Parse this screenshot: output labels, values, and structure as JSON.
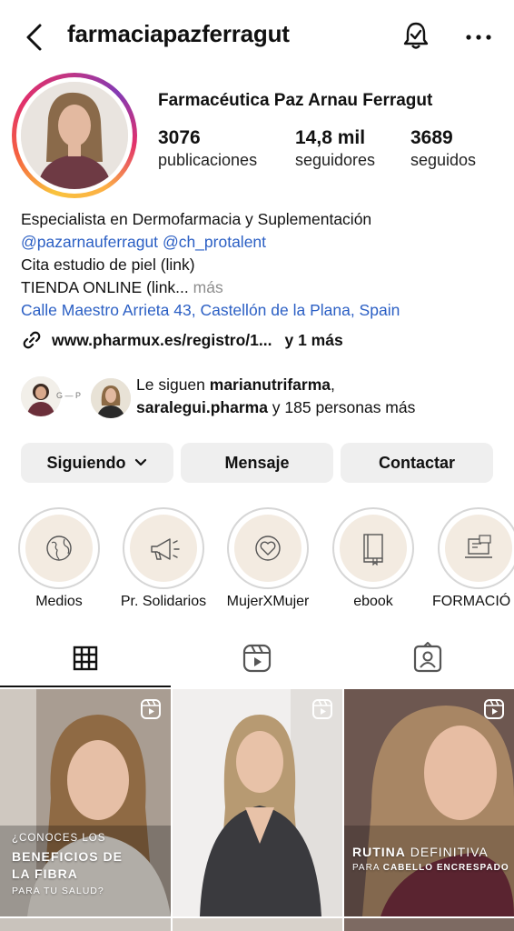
{
  "header": {
    "username": "farmaciapazferragut"
  },
  "profile": {
    "display_name": "Farmacéutica Paz Arnau Ferragut",
    "stats": [
      {
        "value": "3076",
        "label": "publicaciones"
      },
      {
        "value": "14,8 mil",
        "label": "seguidores"
      },
      {
        "value": "3689",
        "label": "seguidos"
      }
    ]
  },
  "bio": {
    "line1": "Especialista en Dermofarmacia y Suplementación",
    "mention1": "@pazarnauferragut",
    "mention2": "@ch_protalent",
    "line3": "Cita estudio de piel (link)",
    "line4": "TIENDA ONLINE (link...",
    "more": " más",
    "address": "Calle Maestro Arrieta 43, Castellón de la Plana, Spain",
    "link": "www.pharmux.es/registro/1...",
    "link_more": "y 1 más"
  },
  "followed_by": {
    "prefix": "Le siguen ",
    "user1": "marianutrifarma",
    "user2": "saralegui.pharma",
    "suffix": " y 185 personas más",
    "avatar_caption": "G — P"
  },
  "buttons": {
    "following": "Siguiendo",
    "message": "Mensaje",
    "contact": "Contactar"
  },
  "highlights": [
    "Medios",
    "Pr. Solidarios",
    "MujerXMujer",
    "ebook",
    "FORMACIÓ"
  ],
  "posts": [
    {
      "l1": "¿CONOCES LOS",
      "l2": "BENEFICIOS DE",
      "l3": "LA FIBRA",
      "l4": "PARA TU SALUD?"
    },
    {},
    {
      "l1b": "RUTINA",
      "l1": " DEFINITIVA",
      "l2": "PARA ",
      "l2b": "CABELLO ENCRESPADO"
    }
  ],
  "colors": {
    "link_blue": "#2b5fc4",
    "button_bg": "#efefef",
    "highlight_bg": "#f3ebe1"
  }
}
